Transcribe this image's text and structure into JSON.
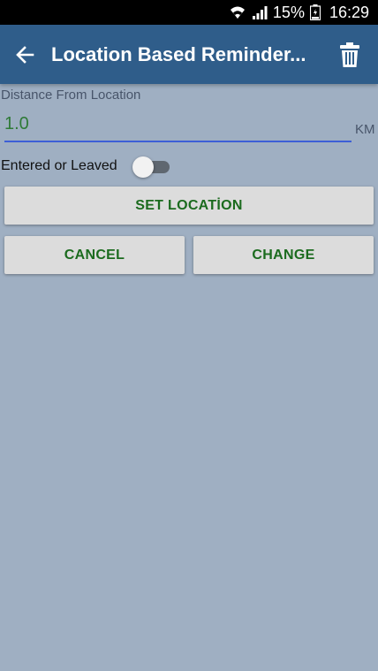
{
  "status_bar": {
    "icons": [
      "wifi-icon",
      "signal-icon",
      "battery-icon"
    ],
    "battery_percent": "15%",
    "time": "16:29"
  },
  "app_bar": {
    "title": "Location Based Reminder...",
    "back_icon": "back-arrow-icon",
    "delete_icon": "trash-icon",
    "color": "#2f5d8a"
  },
  "form": {
    "distance_label": "Distance From Location",
    "distance_value": "1.0",
    "unit": "KM",
    "entered_label": "Entered or Leaved",
    "toggle_on": false
  },
  "buttons": {
    "set_location": "SET LOCATİON",
    "cancel": "CANCEL",
    "change": "CHANGE"
  },
  "colors": {
    "background": "#9fafc2",
    "button_text": "#1b6b1e",
    "input_text": "#2f7a37",
    "input_underline": "#3d5fd6"
  }
}
